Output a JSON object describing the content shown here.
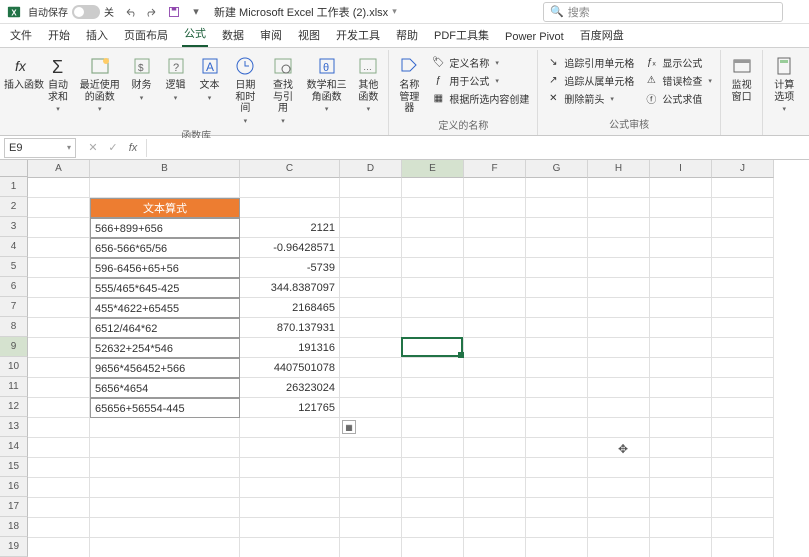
{
  "titlebar": {
    "autosave_label": "自动保存",
    "autosave_state": "关",
    "filename": "新建 Microsoft Excel 工作表 (2).xlsx",
    "search_placeholder": "搜索"
  },
  "tabs": [
    "文件",
    "开始",
    "插入",
    "页面布局",
    "公式",
    "数据",
    "审阅",
    "视图",
    "开发工具",
    "帮助",
    "PDF工具集",
    "Power Pivot",
    "百度网盘"
  ],
  "active_tab": "公式",
  "ribbon": {
    "group1": {
      "insert_fn": "插入函数",
      "autosum": "自动求和",
      "recent": "最近使用的函数",
      "financial": "财务",
      "logical": "逻辑",
      "text": "文本",
      "datetime": "日期和时间",
      "lookup": "查找与引用",
      "math": "数学和三角函数",
      "other": "其他函数",
      "label": "函数库"
    },
    "group2": {
      "name_mgr": "名称管理器",
      "define": "定义名称",
      "use_in": "用于公式",
      "create_from": "根据所选内容创建",
      "label": "定义的名称"
    },
    "group3": {
      "trace_prec": "追踪引用单元格",
      "trace_dep": "追踪从属单元格",
      "remove_arrows": "删除箭头",
      "show_formulas": "显示公式",
      "error_check": "错误检查",
      "eval": "公式求值",
      "label": "公式审核"
    },
    "group4": {
      "watch": "监视窗口"
    },
    "group5": {
      "calc_opts": "计算选项"
    }
  },
  "namebox": "E9",
  "columns": [
    "A",
    "B",
    "C",
    "D",
    "E",
    "F",
    "G",
    "H",
    "I",
    "J"
  ],
  "rows_count": 19,
  "header_b2": "文本算式",
  "data_rows": [
    {
      "b": "566+899+656",
      "c": "2121"
    },
    {
      "b": "656-566*65/56",
      "c": "-0.96428571"
    },
    {
      "b": "596-6456+65+56",
      "c": "-5739"
    },
    {
      "b": "555/465*645-425",
      "c": "344.8387097"
    },
    {
      "b": "455*4622+65455",
      "c": "2168465"
    },
    {
      "b": "6512/464*62",
      "c": "870.137931"
    },
    {
      "b": "52632+254*546",
      "c": "191316"
    },
    {
      "b": "9656*456452+566",
      "c": "4407501078"
    },
    {
      "b": "5656*4654",
      "c": "26323024"
    },
    {
      "b": "65656+56554-445",
      "c": "121765"
    }
  ],
  "sel": {
    "col": "E",
    "row": 9
  }
}
